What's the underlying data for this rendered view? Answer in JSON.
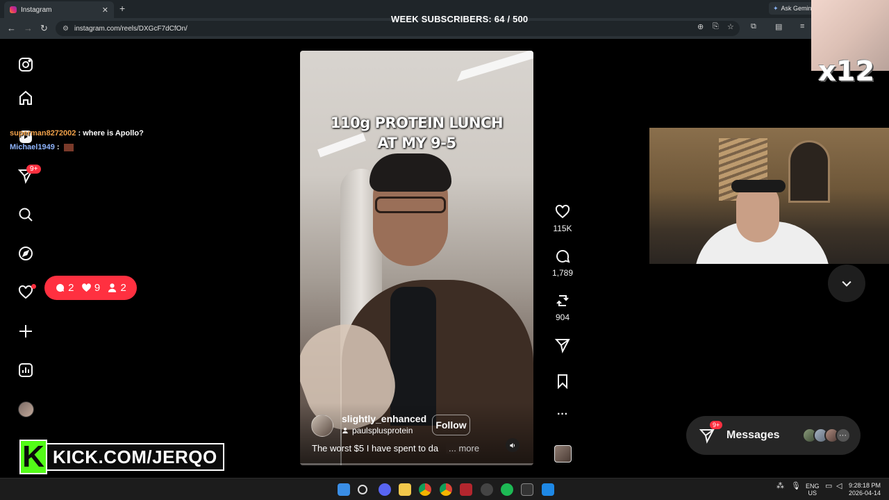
{
  "browser": {
    "tab_title": "Instagram",
    "tab_close": "✕",
    "new_tab": "+",
    "url": "instagram.com/reels/DXGcF7dCfOn/",
    "gemini_label": "Ask Gemini",
    "back": "←",
    "forward": "→",
    "reload": "↻"
  },
  "stream_overlay": {
    "subscribers_text": "WEEK SUBSCRIBERS: 64 / 500",
    "multiplier": "x12",
    "kick_letter": "K",
    "kick_url": "KICK.COM/JERQO"
  },
  "chat": [
    {
      "user": "superman8272002",
      "message": ": where is Apollo?"
    },
    {
      "user": "Michael1949",
      "message": ":"
    }
  ],
  "sidebar": {
    "messages_badge": "9+"
  },
  "notifications_pill": {
    "comments": "2",
    "likes": "9",
    "follows": "2"
  },
  "reel": {
    "overlay_title_line1": "110g PROTEIN LUNCH",
    "overlay_title_line2": "AT MY 9-5",
    "username": "slightly_enhanced",
    "collaborator": "paulsplusprotein",
    "follow_label": "Follow",
    "caption": "The worst $5 I have spent to da",
    "more_label": "... more"
  },
  "actions": {
    "likes": "115K",
    "comments": "1,789",
    "reposts": "904",
    "more": "···"
  },
  "messages_bar": {
    "label": "Messages",
    "badge": "9+",
    "more": "···"
  },
  "taskbar": {
    "lang_top": "ENG",
    "lang_bottom": "US",
    "time": "9:28:18 PM",
    "date": "2026-04-14"
  },
  "colors": {
    "accent_red": "#ff3040",
    "kick_green": "#53fc18"
  }
}
